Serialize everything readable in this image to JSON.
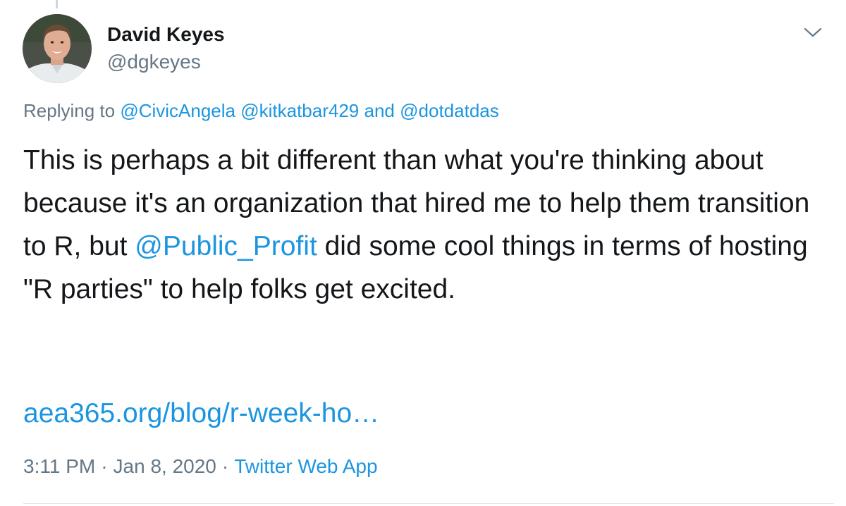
{
  "author": {
    "name": "David Keyes",
    "handle": "@dgkeyes"
  },
  "reply": {
    "prefix": "Replying to ",
    "mention_1": "@CivicAngela",
    "mention_2": "@kitkatbar429",
    "conjunction": "and",
    "mention_3": "@dotdatdas"
  },
  "tweet": {
    "text_before": "This is perhaps a bit different than what you're thinking about because it's an organization that hired me to help them transition to R, but ",
    "mention": "@Public_Profit",
    "text_after": " did some cool things in terms of hosting \"R parties\" to help folks get excited.",
    "link": "aea365.org/blog/r-week-ho…"
  },
  "meta": {
    "time": "3:11 PM",
    "separator": "·",
    "date": "Jan 8, 2020",
    "source": "Twitter Web App"
  },
  "icons": {
    "menu": "chevron-down-icon"
  },
  "colors": {
    "link": "#1b95e0",
    "secondary_text": "#657786",
    "primary_text": "#14171a"
  }
}
